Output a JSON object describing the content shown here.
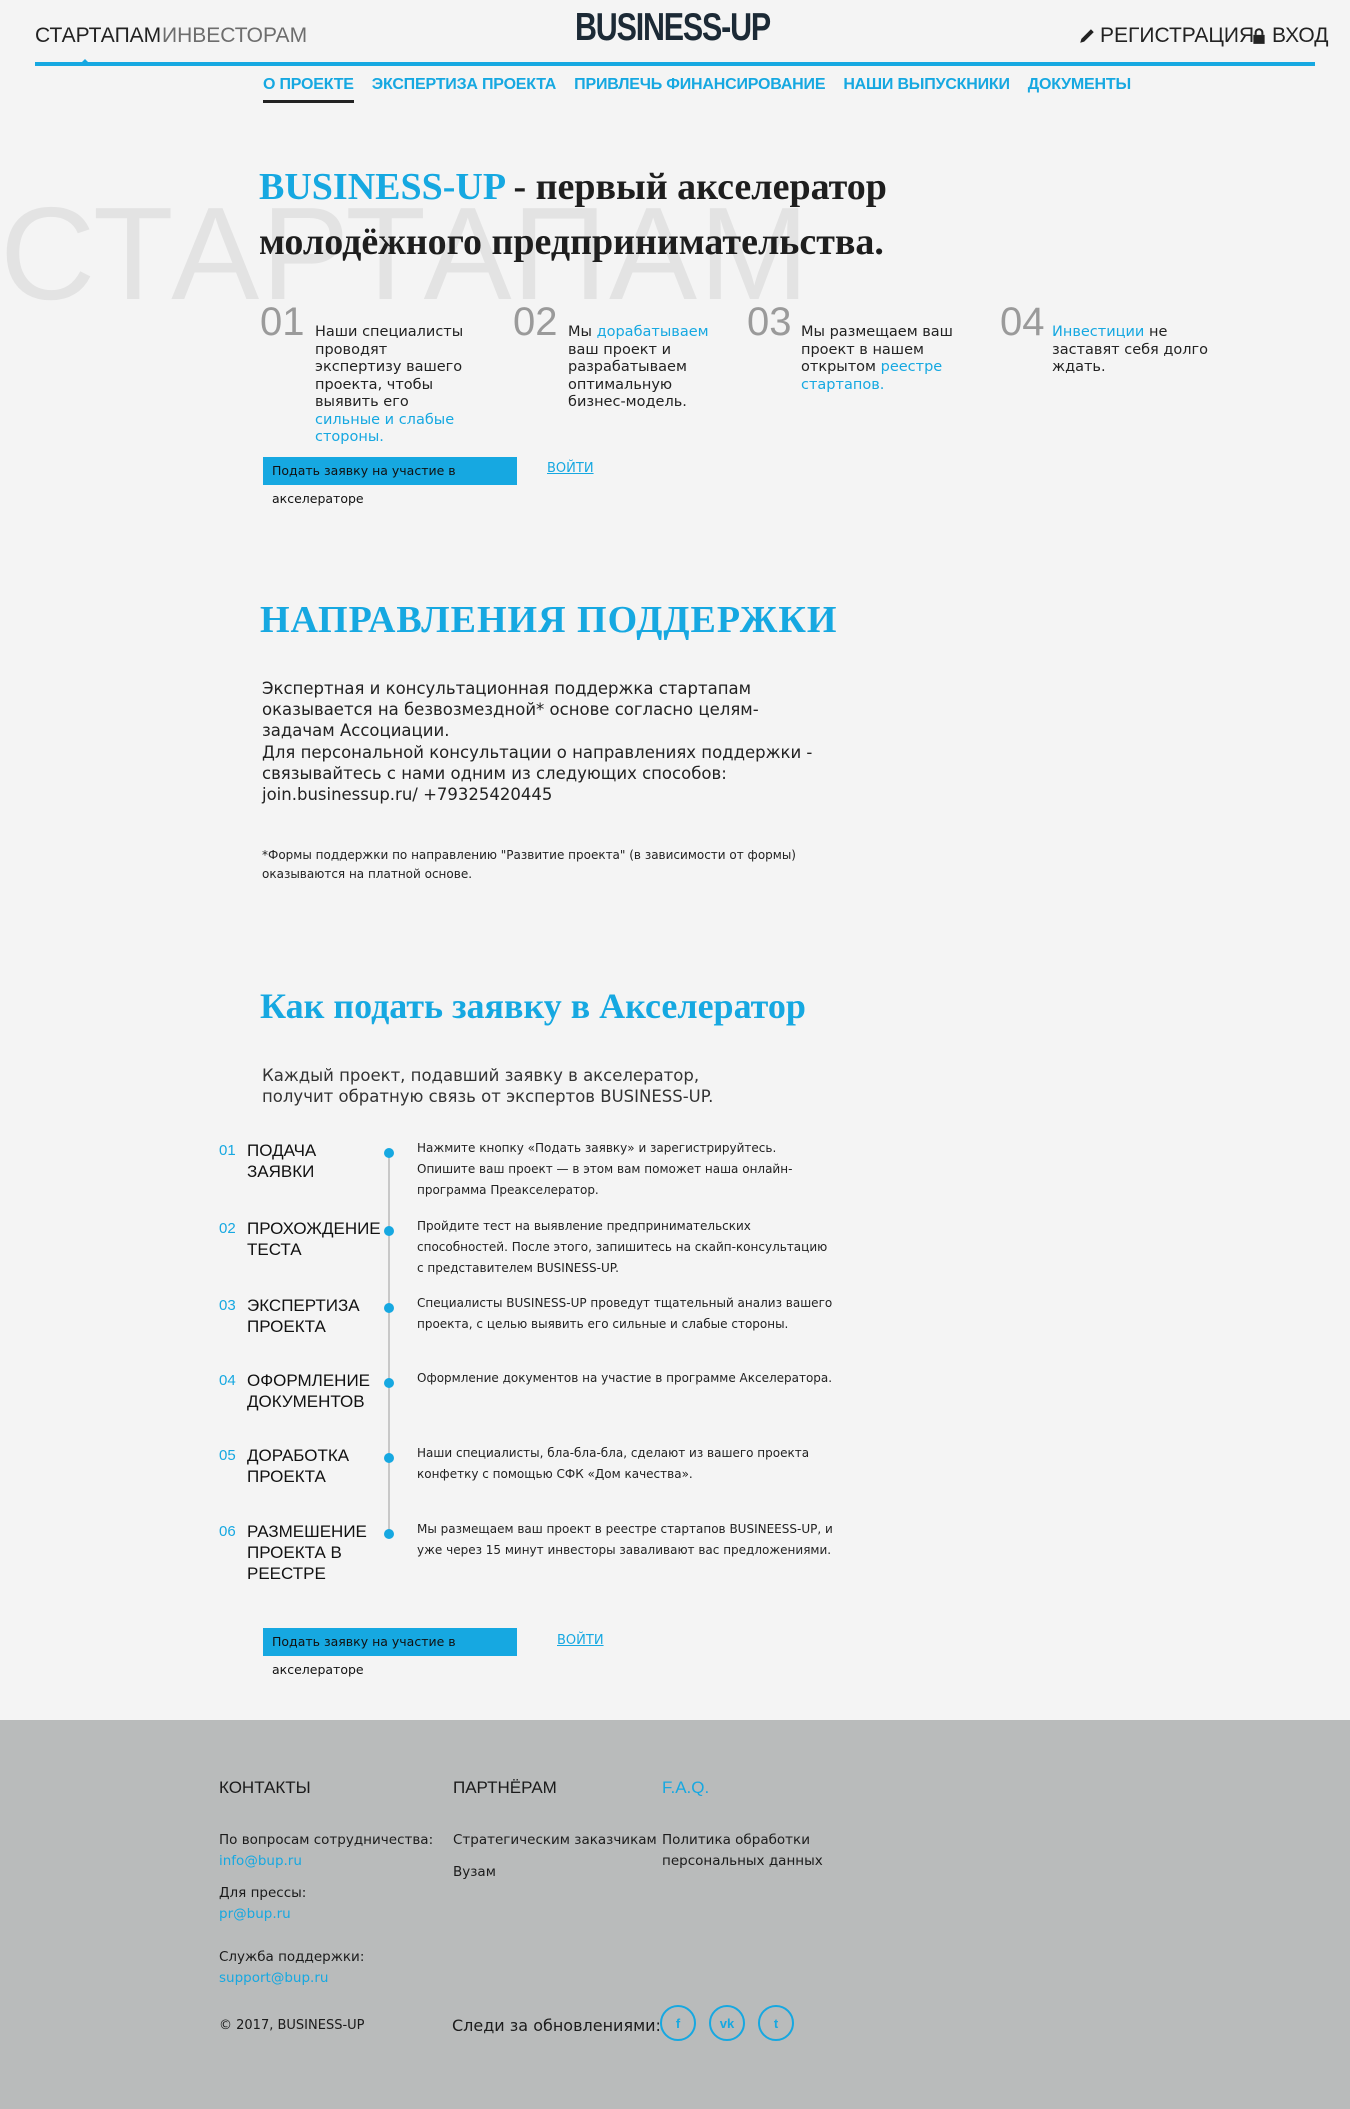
{
  "header": {
    "tabs": [
      "СТАРТАПАМ",
      "ИНВЕСТОРАМ"
    ],
    "logo": "BUSINESS-UP",
    "register": "РЕГИСТРАЦИЯ",
    "login": "ВХОД"
  },
  "subnav": [
    "О ПРОЕКТЕ",
    "ЭКСПЕРТИЗА ПРОЕКТА",
    "ПРИВЛЕЧЬ ФИНАНСИРОВАНИЕ",
    "НАШИ ВЫПУСКНИКИ",
    "ДОКУМЕНТЫ"
  ],
  "hero": {
    "bg_word": "СТАРТАПАМ",
    "brand": "BUSINESS-UP",
    "title_rest": " - первый акселератор молодёжного предпринимательства.",
    "steps": [
      {
        "num": "01",
        "pre": "Наши специалисты проводят экспертизу вашего проекта, чтобы выявить его ",
        "link": "сильные и слабые стороны.",
        "post": ""
      },
      {
        "num": "02",
        "pre": "Мы ",
        "link": "дорабатываем",
        "post": " ваш проект и разрабатываем оптимальную бизнес-модель."
      },
      {
        "num": "03",
        "pre": "Мы размещаем ваш проект в нашем открытом ",
        "link": "реестре стартапов.",
        "post": ""
      },
      {
        "num": "04",
        "pre": "",
        "link": "Инвестиции",
        "post": " не заставят себя долго ждать."
      }
    ],
    "apply_button": "Подать заявку на участие в акселераторе",
    "login_link": "ВОЙТИ"
  },
  "support": {
    "title": "НАПРАВЛЕНИЯ ПОДДЕРЖКИ",
    "p1": "Экспертная и консультационная поддержка стартапам оказывается на безвозмездной* основе согласно целям-задачам Ассоциации.",
    "p2": "Для персональной консультации о направлениях поддержки - связывайтесь с нами одним из следующих способов:",
    "p3": "join.businessup.ru/ +79325420445",
    "footnote": "*Формы поддержки по направлению \"Развитие проекта\" (в зависимости от формы) оказываются на платной основе."
  },
  "how": {
    "title": "Как подать заявку в Акселератор",
    "intro": "Каждый проект, подавший заявку в акселератор, получит обратную связь от экспертов BUSINESS-UP.",
    "steps": [
      {
        "num": "01",
        "title": "ПОДАЧА ЗАЯВКИ",
        "desc": "Нажмите кнопку «Подать заявку» и зарегистрируйтесь. Опишите ваш проект — в этом вам поможет наша онлайн-программа Преакселератор."
      },
      {
        "num": "02",
        "title": "ПРОХОЖДЕНИЕ ТЕСТА",
        "desc": "Пройдите тест на выявление предпринимательских способностей. После этого, запишитесь на скайп-консультацию с представителем BUSINESS-UP."
      },
      {
        "num": "03",
        "title": "ЭКСПЕРТИЗА ПРОЕКТА",
        "desc": "Специалисты BUSINESS-UP проведут тщательный анализ вашего проекта, с целью выявить его сильные и слабые стороны."
      },
      {
        "num": "04",
        "title": "ОФОРМЛЕНИЕ ДОКУМЕНТОВ",
        "desc": "Оформление документов на участие в программе Акселератора."
      },
      {
        "num": "05",
        "title": "ДОРАБОТКА ПРОЕКТА",
        "desc": "Наши специалисты, бла-бла-бла, сделают из вашего проекта конфетку с помощью СФК «Дом качества»."
      },
      {
        "num": "06",
        "title": "РАЗМЕШЕНИЕ ПРОЕКТА В РЕЕСТРЕ",
        "desc": "Мы размещаем ваш проект в реестре стартапов BUSINEESS-UP, и уже через 15 минут инвесторы заваливают вас предложениями."
      }
    ],
    "apply_button": "Подать заявку на участие в акселераторе",
    "login_link": "ВОЙТИ"
  },
  "footer": {
    "contacts": {
      "title": "КОНТАКТЫ",
      "coop_label": "По вопросам сотрудничества:",
      "coop_email": "info@bup.ru",
      "press_label": "Для прессы:",
      "press_email": "pr@bup.ru",
      "support_label": "Служба поддержки:",
      "support_email": "support@bup.ru"
    },
    "partners": {
      "title": "ПАРТНЁРАМ",
      "items": [
        "Стратегическим заказчикам",
        "Вузам"
      ]
    },
    "faq": {
      "title": "F.A.Q.",
      "item": "Политика обработки персональных данных"
    },
    "copyright": "© 2017, BUSINESS-UP",
    "follow": "Следи за обновлениями:",
    "social": [
      {
        "icon": "facebook-icon",
        "glyph": "f"
      },
      {
        "icon": "vk-icon",
        "glyph": "vk"
      },
      {
        "icon": "twitter-icon",
        "glyph": "t"
      }
    ]
  },
  "colors": {
    "accent": "#16a8e1",
    "footer_bg": "#b9bbbb",
    "page_bg": "#f4f4f4"
  }
}
